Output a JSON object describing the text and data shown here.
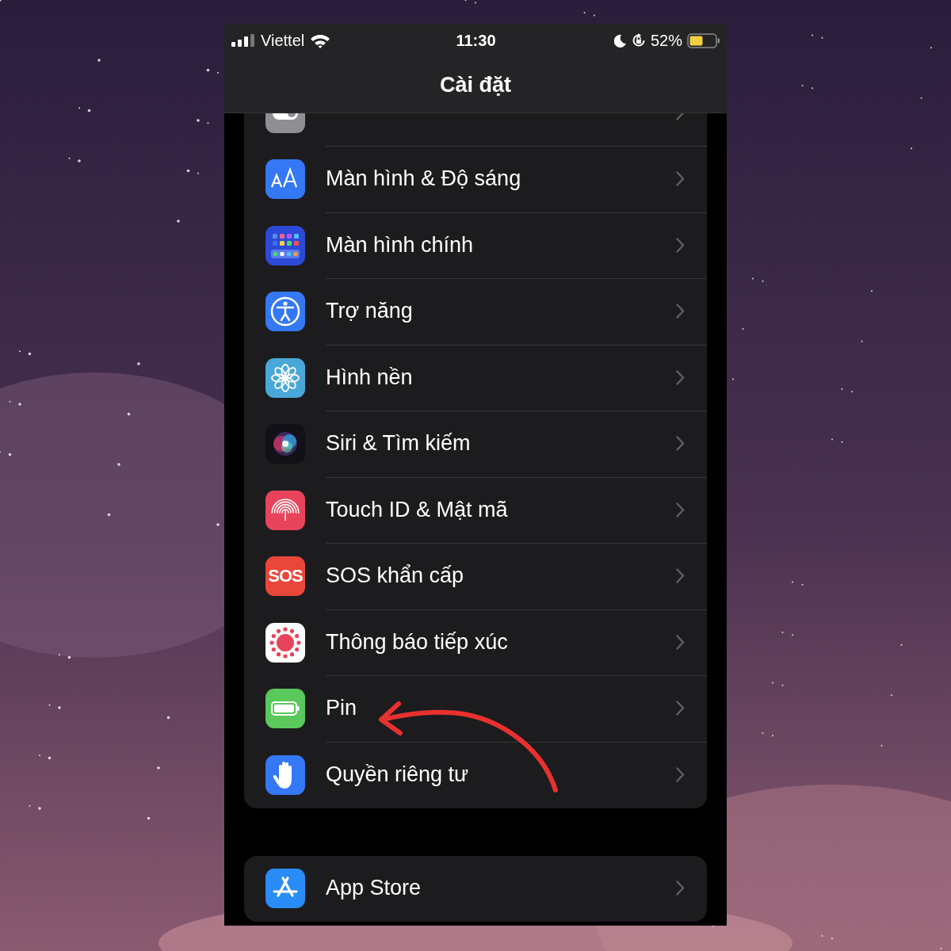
{
  "status_bar": {
    "carrier": "Viettel",
    "time": "11:30",
    "battery": "52%"
  },
  "nav_bar": {
    "title": "Cài đặt"
  },
  "groups": [
    {
      "rows": [
        {
          "kind": "control"
        },
        {
          "kind": "display",
          "label": "Màn hình & Độ sáng"
        },
        {
          "kind": "home",
          "label": "Màn hình chính"
        },
        {
          "kind": "accessibility",
          "label": "Trợ năng"
        },
        {
          "kind": "wallpaper",
          "label": "Hình nền"
        },
        {
          "kind": "siri",
          "label": "Siri & Tìm kiếm"
        },
        {
          "kind": "touchid",
          "label": "Touch ID & Mật mã"
        },
        {
          "kind": "sos",
          "label": "SOS khẩn cấp",
          "icon_text": "SOS"
        },
        {
          "kind": "exposure",
          "label": "Thông báo tiếp xúc"
        },
        {
          "kind": "battery",
          "label": "Pin"
        },
        {
          "kind": "privacy",
          "label": "Quyền riêng tư"
        }
      ]
    },
    {
      "rows": [
        {
          "kind": "appstore",
          "label": "App Store"
        }
      ]
    }
  ],
  "annotation": {
    "kind": "arrow"
  }
}
